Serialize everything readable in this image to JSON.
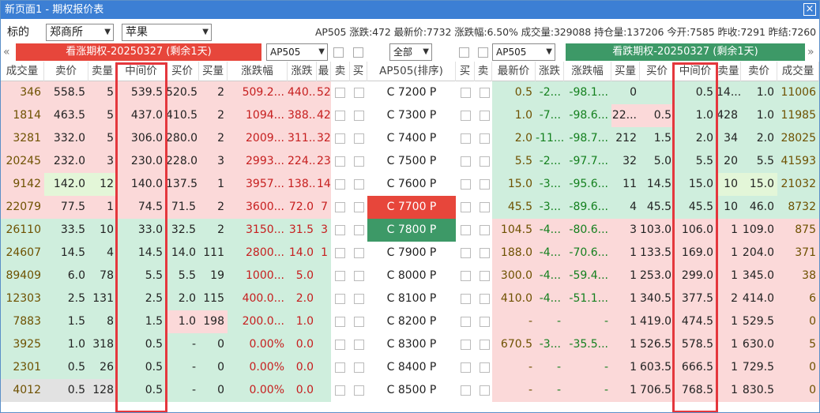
{
  "window": {
    "title": "新页面1 - 期权报价表",
    "close_icon": "close-icon"
  },
  "filter": {
    "label": "标的",
    "exchange": "郑商所",
    "product": "苹果"
  },
  "quote": {
    "contract": "AP505",
    "change": "涨跌:472",
    "last": "最新价:7732",
    "pct": "涨跌幅:6.50%",
    "volume": "成交量:329088",
    "oi": "持仓量:137206",
    "open": "今开:7585",
    "prev_close": "昨收:7291",
    "prev_settle": "昨结:7260"
  },
  "toolbar": {
    "call_title": "看涨期权-20250327 (剩余1天)",
    "put_title": "看跌期权-20250327 (剩余1天)",
    "call_contract": "AP505",
    "all": "全部",
    "put_contract": "AP505",
    "left_arrow": "«",
    "right_arrow": "»"
  },
  "headers": {
    "call": [
      "成交量",
      "卖价",
      "卖量",
      "中间价",
      "买价",
      "买量",
      "涨跌幅",
      "涨跌",
      "最",
      "卖",
      "买"
    ],
    "center": "AP505(排序)",
    "put": [
      "买",
      "卖",
      "最新价",
      "涨跌",
      "涨跌幅",
      "买量",
      "买价",
      "中间价",
      "卖量",
      "卖价",
      "成交量"
    ]
  },
  "rows": [
    {
      "cv": "346",
      "cap": "558.5",
      "caq": "5",
      "cm": "539.5",
      "cbp": "520.5",
      "cbq": "2",
      "cpct": "509.2...",
      "cchg": "440...",
      "cl": "52",
      "strike": "7200",
      "pl": "0.5",
      "pchg": "-2...",
      "ppct": "-98.1...",
      "pbq": "0",
      "pbp": "",
      "pm": "0.5",
      "paq": "14...",
      "pap": "1.0",
      "pv": "11006"
    },
    {
      "cv": "1814",
      "cap": "463.5",
      "caq": "5",
      "cm": "437.0",
      "cbp": "410.5",
      "cbq": "2",
      "cpct": "1094...",
      "cchg": "388...",
      "cl": "42",
      "strike": "7300",
      "pl": "1.0",
      "pchg": "-7...",
      "ppct": "-98.6...",
      "pbq": "22...",
      "pbp": "0.5",
      "pm": "1.0",
      "paq": "428",
      "pap": "1.0",
      "pv": "11985"
    },
    {
      "cv": "3281",
      "cap": "332.0",
      "caq": "5",
      "cm": "306.0",
      "cbp": "280.0",
      "cbq": "2",
      "cpct": "2009...",
      "cchg": "311...",
      "cl": "32",
      "strike": "7400",
      "pl": "2.0",
      "pchg": "-11...",
      "ppct": "-98.7...",
      "pbq": "212",
      "pbp": "1.5",
      "pm": "2.0",
      "paq": "34",
      "pap": "2.0",
      "pv": "28025"
    },
    {
      "cv": "20245",
      "cap": "232.0",
      "caq": "3",
      "cm": "230.0",
      "cbp": "228.0",
      "cbq": "3",
      "cpct": "2993...",
      "cchg": "224...",
      "cl": "23",
      "strike": "7500",
      "pl": "5.5",
      "pchg": "-2...",
      "ppct": "-97.7...",
      "pbq": "32",
      "pbp": "5.0",
      "pm": "5.5",
      "paq": "20",
      "pap": "5.5",
      "pv": "41593"
    },
    {
      "cv": "9142",
      "cap": "142.0",
      "caq": "12",
      "cm": "140.0",
      "cbp": "137.5",
      "cbq": "1",
      "cpct": "3957...",
      "cchg": "138...",
      "cl": "14",
      "strike": "7600",
      "pl": "15.0",
      "pchg": "-3...",
      "ppct": "-95.6...",
      "pbq": "11",
      "pbp": "14.5",
      "pm": "15.0",
      "paq": "10",
      "pap": "15.0",
      "pv": "21032"
    },
    {
      "cv": "22079",
      "cap": "77.5",
      "caq": "1",
      "cm": "74.5",
      "cbp": "71.5",
      "cbq": "2",
      "cpct": "3600...",
      "cchg": "72.0",
      "cl": "7",
      "strike": "7700",
      "pl": "45.5",
      "pchg": "-3...",
      "ppct": "-89.6...",
      "pbq": "4",
      "pbp": "45.5",
      "pm": "45.5",
      "paq": "10",
      "pap": "46.0",
      "pv": "8732"
    },
    {
      "cv": "26110",
      "cap": "33.5",
      "caq": "10",
      "cm": "33.0",
      "cbp": "32.5",
      "cbq": "2",
      "cpct": "3150...",
      "cchg": "31.5",
      "cl": "3",
      "strike": "7800",
      "pl": "104.5",
      "pchg": "-4...",
      "ppct": "-80.6...",
      "pbq": "3",
      "pbp": "103.0",
      "pm": "106.0",
      "paq": "1",
      "pap": "109.0",
      "pv": "875"
    },
    {
      "cv": "24607",
      "cap": "14.5",
      "caq": "4",
      "cm": "14.5",
      "cbp": "14.0",
      "cbq": "111",
      "cpct": "2800...",
      "cchg": "14.0",
      "cl": "1",
      "strike": "7900",
      "pl": "188.0",
      "pchg": "-4...",
      "ppct": "-70.6...",
      "pbq": "1",
      "pbp": "133.5",
      "pm": "169.0",
      "paq": "1",
      "pap": "204.0",
      "pv": "371"
    },
    {
      "cv": "89409",
      "cap": "6.0",
      "caq": "78",
      "cm": "5.5",
      "cbp": "5.5",
      "cbq": "19",
      "cpct": "1000...",
      "cchg": "5.0",
      "cl": "",
      "strike": "8000",
      "pl": "300.0",
      "pchg": "-4...",
      "ppct": "-59.4...",
      "pbq": "1",
      "pbp": "253.0",
      "pm": "299.0",
      "paq": "1",
      "pap": "345.0",
      "pv": "38"
    },
    {
      "cv": "12303",
      "cap": "2.5",
      "caq": "131",
      "cm": "2.5",
      "cbp": "2.0",
      "cbq": "115",
      "cpct": "400.0...",
      "cchg": "2.0",
      "cl": "",
      "strike": "8100",
      "pl": "410.0",
      "pchg": "-4...",
      "ppct": "-51.1...",
      "pbq": "1",
      "pbp": "340.5",
      "pm": "377.5",
      "paq": "2",
      "pap": "414.0",
      "pv": "6"
    },
    {
      "cv": "7883",
      "cap": "1.5",
      "caq": "8",
      "cm": "1.5",
      "cbp": "1.0",
      "cbq": "198",
      "cpct": "200.0...",
      "cchg": "1.0",
      "cl": "",
      "strike": "8200",
      "pl": "-",
      "pchg": "-",
      "ppct": "-",
      "pbq": "1",
      "pbp": "419.0",
      "pm": "474.5",
      "paq": "1",
      "pap": "529.5",
      "pv": "0"
    },
    {
      "cv": "3925",
      "cap": "1.0",
      "caq": "318",
      "cm": "0.5",
      "cbp": "-",
      "cbq": "0",
      "cpct": "0.00%",
      "cchg": "0.0",
      "cl": "",
      "strike": "8300",
      "pl": "670.5",
      "pchg": "-3...",
      "ppct": "-35.5...",
      "pbq": "1",
      "pbp": "526.5",
      "pm": "578.5",
      "paq": "1",
      "pap": "630.0",
      "pv": "5"
    },
    {
      "cv": "2301",
      "cap": "0.5",
      "caq": "26",
      "cm": "0.5",
      "cbp": "-",
      "cbq": "0",
      "cpct": "0.00%",
      "cchg": "0.0",
      "cl": "",
      "strike": "8400",
      "pl": "-",
      "pchg": "-",
      "ppct": "-",
      "pbq": "1",
      "pbp": "603.5",
      "pm": "666.5",
      "paq": "1",
      "pap": "729.5",
      "pv": "0"
    },
    {
      "cv": "4012",
      "cap": "0.5",
      "caq": "128",
      "cm": "0.5",
      "cbp": "-",
      "cbq": "0",
      "cpct": "0.00%",
      "cchg": "0.0",
      "cl": "",
      "strike": "8500",
      "pl": "-",
      "pchg": "-",
      "ppct": "-",
      "pbq": "1",
      "pbp": "706.5",
      "pm": "768.5",
      "paq": "1",
      "pap": "830.5",
      "pv": "0"
    }
  ],
  "colors": {
    "pink": "#fbd9d9",
    "green": "#cfeedd",
    "lightgreen": "#e3f6d8",
    "atm_red": "#e7463b",
    "atm_green": "#3d9967"
  }
}
